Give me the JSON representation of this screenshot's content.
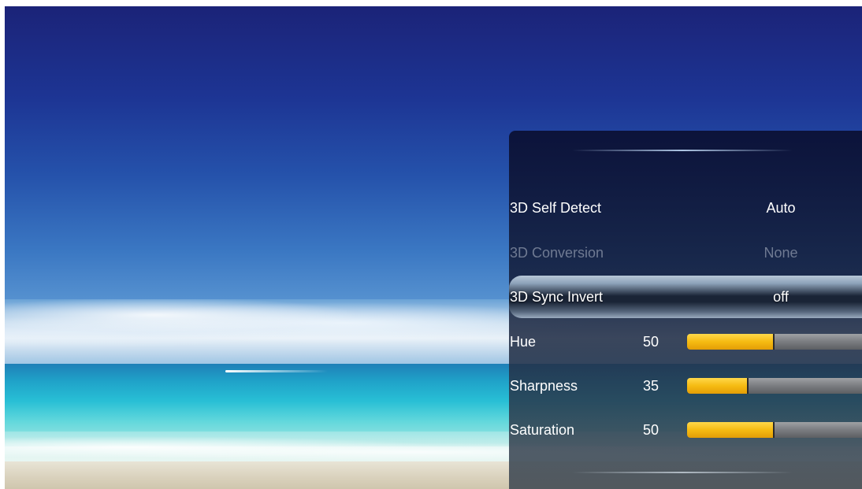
{
  "menu": {
    "items": [
      {
        "label": "3D Self Detect",
        "value": "Auto"
      },
      {
        "label": "3D Conversion",
        "value": "None"
      },
      {
        "label": "3D Sync Invert",
        "value": "off"
      }
    ],
    "sliders": [
      {
        "label": "Hue",
        "value": "50",
        "fraction": 0.5
      },
      {
        "label": "Sharpness",
        "value": "35",
        "fraction": 0.35
      },
      {
        "label": "Saturation",
        "value": "50",
        "fraction": 0.5
      }
    ]
  },
  "colors": {
    "slider_fill": "#f6bb12",
    "slider_track": "#7a7c80",
    "disabled_text": "#6f7a92"
  }
}
